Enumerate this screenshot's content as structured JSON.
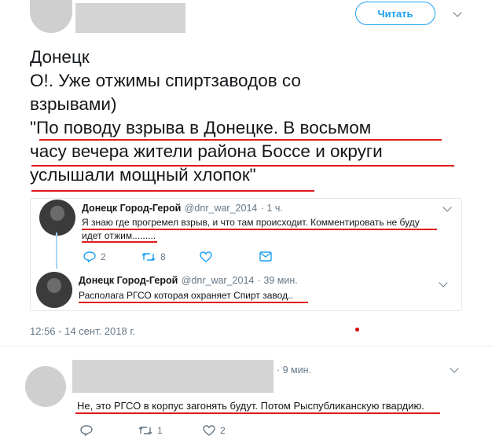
{
  "header": {
    "follow_label": "Читать"
  },
  "tweet": {
    "lines": [
      "Донецк",
      "О!.  Уже отжимы спиртзаводов со",
      "взрывами)",
      "\"По поводу взрыва в Донецке. В восьмом",
      "часу вечера жители района Боссе и округи",
      "услышали мощный хлопок\""
    ],
    "timestamp": "12:56 - 14 сент. 2018 г."
  },
  "quote": {
    "first": {
      "name": "Донецк Город-Герой",
      "handle": "@dnr_war_2014",
      "time": "· 1 ч.",
      "line1": "Я знаю где прогремел взрыв, и что там происходит. Комментировать не буду",
      "line2": "идет отжим.........",
      "replies": "2",
      "retweets": "8"
    },
    "second": {
      "name": "Донецк Город-Герой",
      "handle": "@dnr_war_2014",
      "time": "· 39 мин.",
      "text": "Располага РГСО которая охраняет Спирт завод.."
    }
  },
  "reply": {
    "time": "· 9 мин.",
    "text": "Не, это РГСО в корпус загонять будут. Потом Рыспубликанскую гвардию.",
    "retweets": "1",
    "likes": "2"
  },
  "colors": {
    "accent": "#1da1f2",
    "underline": "#e01b1b",
    "muted": "#657786"
  }
}
